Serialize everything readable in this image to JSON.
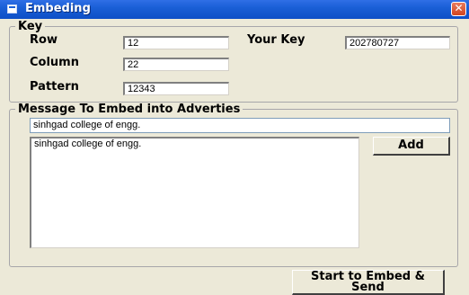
{
  "window": {
    "title": "Embeding",
    "close_glyph": "✕"
  },
  "key_group": {
    "legend": "Key",
    "row_label": "Row",
    "row_value": "12",
    "column_label": "Column",
    "column_value": "22",
    "pattern_label": "Pattern",
    "pattern_value": "12343",
    "your_key_label": "Your Key",
    "your_key_value": "202780727"
  },
  "message_group": {
    "legend": "Message To Embed into Adverties",
    "message_input_value": "sinhgad college of engg.",
    "message_list": [
      "sinhgad college of engg."
    ],
    "add_button_label": "Add"
  },
  "footer": {
    "start_button_label_line1": "Start to Embed &",
    "start_button_label_line2": "Send"
  },
  "colors": {
    "titlebar": "#0e4fc6",
    "window_bg": "#ece9d8"
  }
}
